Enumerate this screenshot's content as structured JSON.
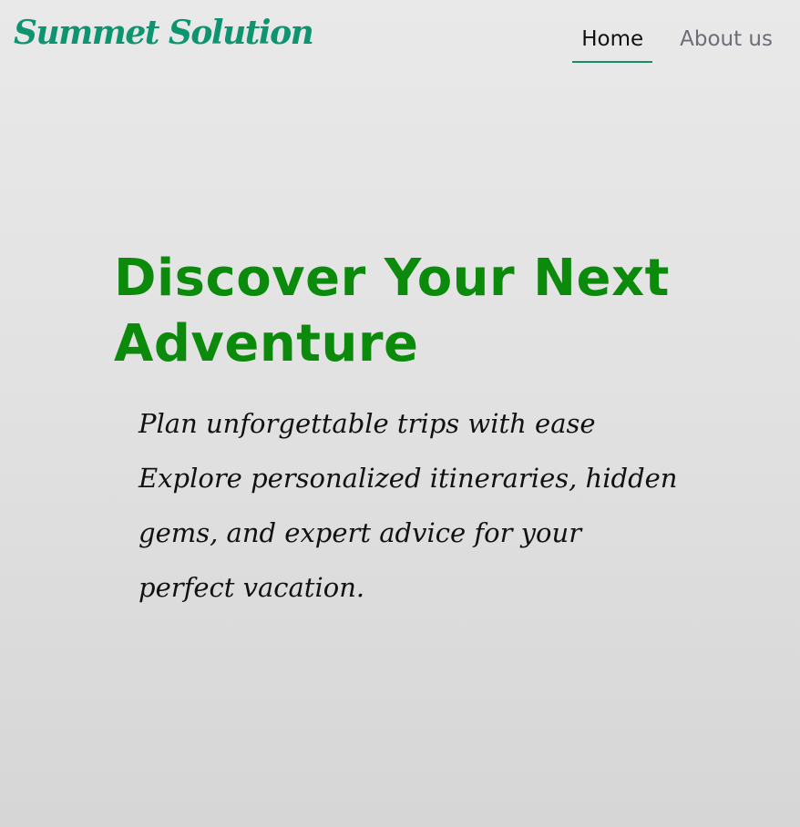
{
  "brand": {
    "name": "Summet Solution",
    "color": "#0e9470"
  },
  "nav": {
    "items": [
      {
        "label": "Home",
        "active": true
      },
      {
        "label": "About us",
        "active": false
      }
    ],
    "active_underline_color": "#1a8a6c"
  },
  "hero": {
    "title": "Discover Your Next Adventure",
    "title_color": "#0b8a0b",
    "description": "Plan unforgettable trips with ease Explore personalized itineraries, hidden gems, and expert advice for your perfect vacation."
  }
}
